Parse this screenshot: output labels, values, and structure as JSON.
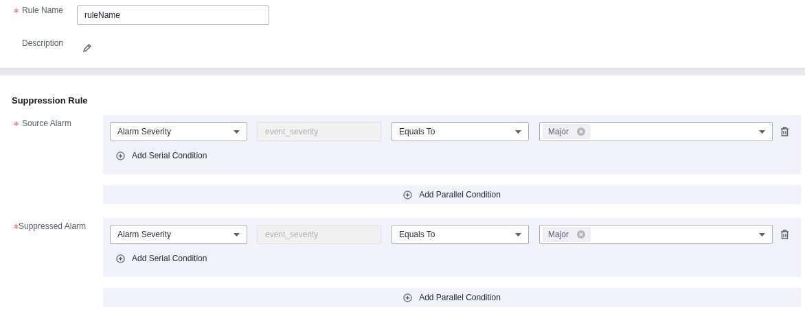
{
  "basic": [
    {
      "label": "Rule Name",
      "required": true,
      "kind": "input",
      "value": "ruleName"
    },
    {
      "label": "Description",
      "kind": "edit"
    }
  ],
  "section_title": "Suppression Rule",
  "alarms": [
    {
      "label": "Source Alarm",
      "required": true,
      "conditions": [
        {
          "field": "Alarm Severity",
          "key": "event_severity",
          "operator": "Equals To",
          "tags": [
            "Major"
          ]
        }
      ],
      "add_serial": "Add Serial Condition",
      "add_parallel": "Add Parallel Condition"
    },
    {
      "label": "Suppressed Alarm",
      "required": true,
      "conditions": [
        {
          "field": "Alarm Severity",
          "key": "event_severity",
          "operator": "Equals To",
          "tags": [
            "Major"
          ]
        }
      ],
      "add_serial": "Add Serial Condition",
      "add_parallel": "Add Parallel Condition"
    }
  ]
}
